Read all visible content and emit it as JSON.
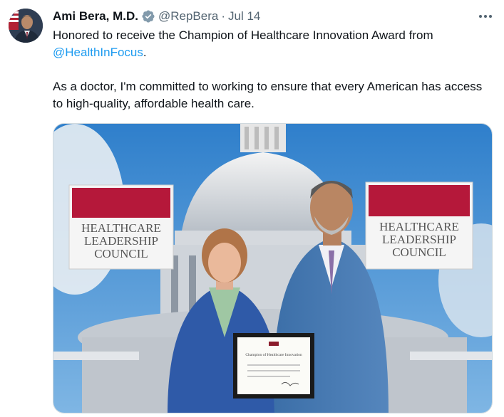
{
  "tweet": {
    "author": {
      "name": "Ami Bera, M.D.",
      "handle": "@RepBera",
      "verified_icon": "verified-badge-icon"
    },
    "separator": "·",
    "date": "Jul 14",
    "more_icon": "more-options-icon",
    "text": {
      "line1_prefix": "Honored to receive the Champion of Healthcare Innovation Award from",
      "mention": "@HealthInFocus",
      "line1_suffix": ".",
      "paragraph2": "As a doctor, I'm committed to working to ensure that every American has access to high-quality, affordable health care."
    },
    "media": {
      "sign_left": [
        "HEALTHCARE",
        "LEADERSHIP",
        "COUNCIL"
      ],
      "sign_right": [
        "HEALTHCARE",
        "LEADERSHIP",
        "COUNCIL"
      ],
      "certificate_title": "Champion of Healthcare Innovation"
    }
  },
  "colors": {
    "link": "#1d9bf0",
    "secondary_text": "#536471",
    "verified": "#1d9bf0",
    "sky": "#3e8fd6",
    "sign_red": "#b5183a"
  }
}
